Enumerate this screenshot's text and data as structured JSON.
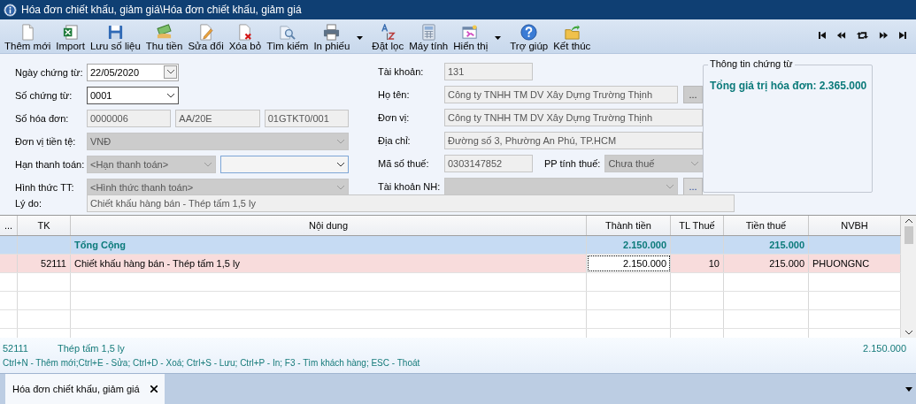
{
  "window": {
    "title": "Hóa đơn chiết khấu, giảm giá\\Hóa đơn chiết khấu, giảm giá"
  },
  "toolbar": {
    "buttons": [
      {
        "label": "Thêm mới",
        "has_menu": false
      },
      {
        "label": "Import",
        "has_menu": false
      },
      {
        "label": "Lưu số liệu",
        "has_menu": false
      },
      {
        "label": "Thu tiền",
        "has_menu": false
      },
      {
        "label": "Sửa đổi",
        "has_menu": false
      },
      {
        "label": "Xóa bỏ",
        "has_menu": false
      },
      {
        "label": "Tìm kiếm",
        "has_menu": false
      },
      {
        "label": "In phiếu",
        "has_menu": true
      },
      {
        "label": "Đặt lọc",
        "has_menu": false
      },
      {
        "label": "Máy tính",
        "has_menu": false
      },
      {
        "label": "Hiển thị",
        "has_menu": true
      },
      {
        "label": "Trợ giúp",
        "has_menu": false
      },
      {
        "label": "Kết thúc",
        "has_menu": false
      }
    ]
  },
  "form": {
    "left": [
      {
        "label": "Ngày chứng từ:",
        "fields": [
          {
            "kind": "date",
            "value": "22/05/2020",
            "disabled": false
          }
        ]
      },
      {
        "label": "Số chứng từ:",
        "fields": [
          {
            "kind": "combo-short",
            "value": "0001",
            "disabled": false
          }
        ]
      },
      {
        "label": "Số hóa đơn:",
        "fields": [
          {
            "kind": "text",
            "value": "0000006",
            "disabled": true
          },
          {
            "kind": "text",
            "value": "AA/20E",
            "disabled": true
          },
          {
            "kind": "text",
            "value": "01GTKT0/001",
            "disabled": true
          }
        ]
      },
      {
        "label": "Đơn vị tiền tệ:",
        "fields": [
          {
            "kind": "combo",
            "value": "VNĐ",
            "disabled": true
          }
        ]
      },
      {
        "label": "Hạn thanh toán:",
        "fields": [
          {
            "kind": "combo",
            "value": "<Hạn thanh toán>",
            "disabled": true
          },
          {
            "kind": "combo",
            "disabled": false
          }
        ]
      },
      {
        "label": "Hình thức TT:",
        "fields": [
          {
            "kind": "combo",
            "value": "<Hình thức thanh toán>",
            "disabled": true
          }
        ]
      }
    ],
    "right": [
      {
        "label": "Tài khoản:",
        "fields": [
          {
            "kind": "text-short",
            "value": "131",
            "disabled": true
          }
        ]
      },
      {
        "label": "Họ tên:",
        "fields": [
          {
            "kind": "text",
            "value": "Công ty TNHH TM DV Xây Dựng Trường Thịnh",
            "disabled": true
          },
          {
            "kind": "button",
            "value": "...",
            "disabled": true
          }
        ]
      },
      {
        "label": "Đơn vị:",
        "fields": [
          {
            "kind": "text",
            "value": "Công ty TNHH TM DV Xây Dựng Trường Thịnh",
            "disabled": true
          }
        ]
      },
      {
        "label": "Địa chỉ:",
        "fields": [
          {
            "kind": "text",
            "value": "Đường số 3, Phường An Phú, TP.HCM",
            "disabled": true
          }
        ]
      },
      {
        "label": "Mã số thuế:",
        "fields": [
          {
            "kind": "text-short",
            "value": "0303147852",
            "disabled": true
          },
          {
            "kind": "label",
            "value": "PP tính thuế:"
          },
          {
            "kind": "combo",
            "value": "Chưa thuế",
            "disabled": true
          }
        ]
      },
      {
        "label": "Tài khoản NH:",
        "fields": [
          {
            "kind": "combo",
            "disabled": true
          },
          {
            "kind": "button",
            "value": "...",
            "disabled": false
          }
        ]
      }
    ],
    "reason": {
      "label": "Lý do:",
      "value": "Chiết khấu hàng bán - Thép tấm 1,5 ly",
      "disabled": true
    }
  },
  "info_panel": {
    "title": "Thông tin chứng từ",
    "total": "Tổng giá trị hóa đơn: 2.365.000"
  },
  "table": {
    "columns": [
      "...",
      "TK",
      "Nội dung",
      "Thành tiền",
      "TL Thuế",
      "Tiền thuế",
      "NVBH"
    ],
    "rows": [
      {
        "kind": "total",
        "cells": [
          null,
          null,
          {
            "text": "Tổng Cộng",
            "focused": false
          },
          {
            "text": "2.150.000",
            "focused": false
          },
          null,
          {
            "text": "215.000",
            "focused": false
          },
          null
        ]
      },
      {
        "kind": "item",
        "selected": true,
        "cells": [
          null,
          {
            "text": "52111",
            "focused": false
          },
          {
            "text": "Chiết khấu hàng bán - Thép tấm 1,5 ly",
            "focused": false
          },
          {
            "text": "2.150.000",
            "focused": true
          },
          {
            "text": "10",
            "focused": false
          },
          {
            "text": "215.000",
            "focused": false
          },
          {
            "text": "PHUONGNC",
            "focused": false
          }
        ]
      }
    ]
  },
  "status": {
    "code": "52111",
    "name": "Thép tấm 1,5 ly",
    "amount": "2.150.000",
    "shortcuts": "Ctrl+N - Thêm mới;Ctrl+E - Sửa; Ctrl+D - Xoá; Ctrl+S - Lưu; Ctrl+P - In; F3 - Tìm khách hàng; ESC - Thoát"
  },
  "tabs": [
    {
      "label": "Hóa đơn chiết khấu, giảm giá",
      "selected": true
    }
  ]
}
